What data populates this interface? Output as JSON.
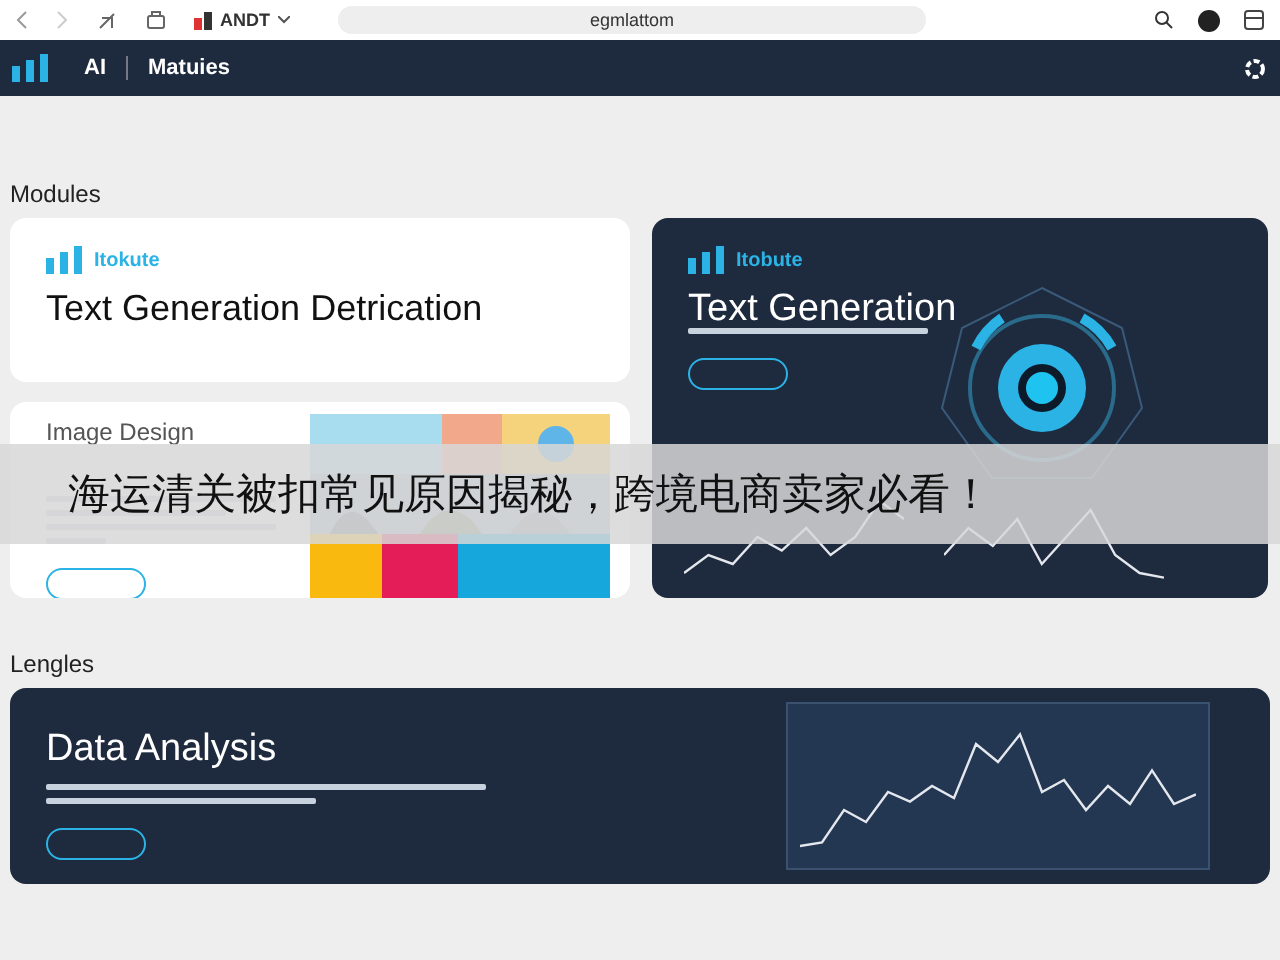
{
  "browser": {
    "profile": "ANDT",
    "address": "egmlattom"
  },
  "nav": {
    "brand": "AI",
    "section": "Matuies"
  },
  "sections": [
    {
      "heading": "Modules",
      "cards": [
        {
          "kind": "light",
          "tag": "Itokute",
          "title": "Text Generation Detrication"
        },
        {
          "title": "Image Design"
        },
        {
          "kind": "dark",
          "tag": "Itobute",
          "title": "Text Generation"
        }
      ]
    },
    {
      "heading": "Lengles",
      "cards": [
        {
          "kind": "wide",
          "title": "Data Analysis"
        }
      ]
    }
  ],
  "caption": "海运清关被扣常见原因揭秘，跨境电商卖家必看！"
}
